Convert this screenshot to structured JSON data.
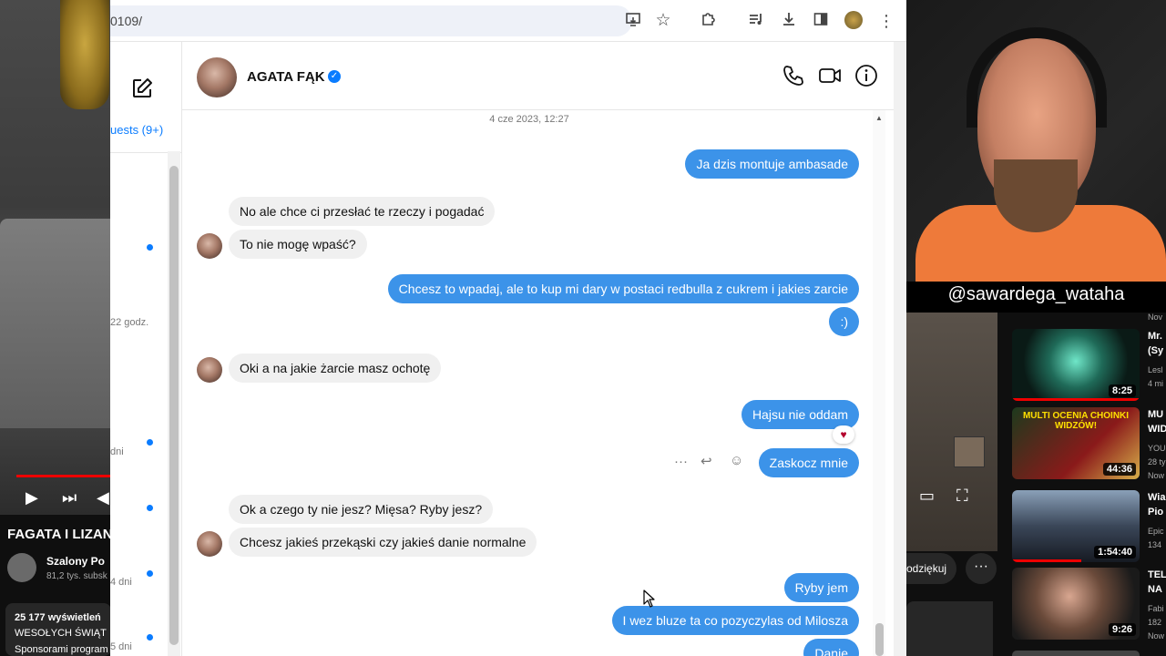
{
  "youtube_left": {
    "video_title": "FAGATA I LIZAN",
    "channel_name": "Szalony Po",
    "channel_subs": "81,2 tys. subsk",
    "desc_views": "25 177 wyświetleń",
    "desc_line1": "WESOŁYCH ŚWIĄT",
    "desc_line2": "Sponsorami program"
  },
  "browser": {
    "url": "0109/",
    "icons": [
      "cast-icon",
      "star-icon",
      "extensions-icon",
      "media-icon",
      "download-icon",
      "sidepanel-icon",
      "profile-icon",
      "menu-icon"
    ]
  },
  "sidebar": {
    "requests_label": "uests (9+)",
    "times": [
      "22 godz.",
      "dni",
      "4 dni",
      "5 dni"
    ]
  },
  "chat": {
    "contact_name": "AGATA FĄK",
    "verified": true,
    "timestamp": "4 cze 2023, 12:27",
    "messages": [
      {
        "dir": "out",
        "text": "Ja dzis montuje ambasade"
      },
      {
        "dir": "in",
        "text": "No ale chce ci przesłać te rzeczy i pogadać"
      },
      {
        "dir": "in",
        "text": "To nie mogę wpaść?"
      },
      {
        "dir": "out",
        "text": "Chcesz to wpadaj, ale to kup mi dary w postaci redbulla z cukrem i jakies zarcie"
      },
      {
        "dir": "out",
        "text": ":)"
      },
      {
        "dir": "in",
        "text": "Oki a na jakie żarcie masz ochotę"
      },
      {
        "dir": "out",
        "text": "Hajsu nie oddam",
        "reaction": "♥"
      },
      {
        "dir": "out",
        "text": "Zaskocz mnie"
      },
      {
        "dir": "in",
        "text": "Ok a czego ty nie jesz? Mięsa? Ryby jesz?"
      },
      {
        "dir": "in",
        "text": "Chcesz jakieś przekąski czy jakieś danie normalne"
      },
      {
        "dir": "out",
        "text": "Ryby jem"
      },
      {
        "dir": "out",
        "text": "I wez bluze ta co pozyczylas od Milosza"
      },
      {
        "dir": "out",
        "text": "Danie"
      }
    ],
    "hover_actions": [
      "···",
      "↩",
      "☺"
    ]
  },
  "webcam": {
    "caption": "@sawardega_wataha"
  },
  "youtube_right": {
    "thanks_label": "odziękuj",
    "more_label": "···",
    "recommendations": [
      {
        "title": "Mr.",
        "title2": "(Sy",
        "meta": "Lesl",
        "meta2": "4 mi",
        "duration": "8:25"
      },
      {
        "title": "MU",
        "title2": "WID",
        "meta": "YOU",
        "meta2": "28 ty",
        "meta3": "Now",
        "duration": "44:36",
        "overlay": "MULTI OCENIA CHOINKI WIDZÓW!"
      },
      {
        "title": "Wia",
        "title2": "Pio",
        "meta": "Epic",
        "meta2": "134",
        "duration": "1:54:40"
      },
      {
        "title": "TEL",
        "title2": "NA",
        "meta": "Fabi",
        "meta2": "182",
        "meta3": "Now",
        "duration": "9:26"
      }
    ],
    "top_meta": "Nov"
  },
  "colors": {
    "outgoing_bubble": "#3c93e9",
    "incoming_bubble": "#f0f0f0",
    "messenger_blue": "#0a7cff",
    "youtube_red": "#ee0000"
  }
}
